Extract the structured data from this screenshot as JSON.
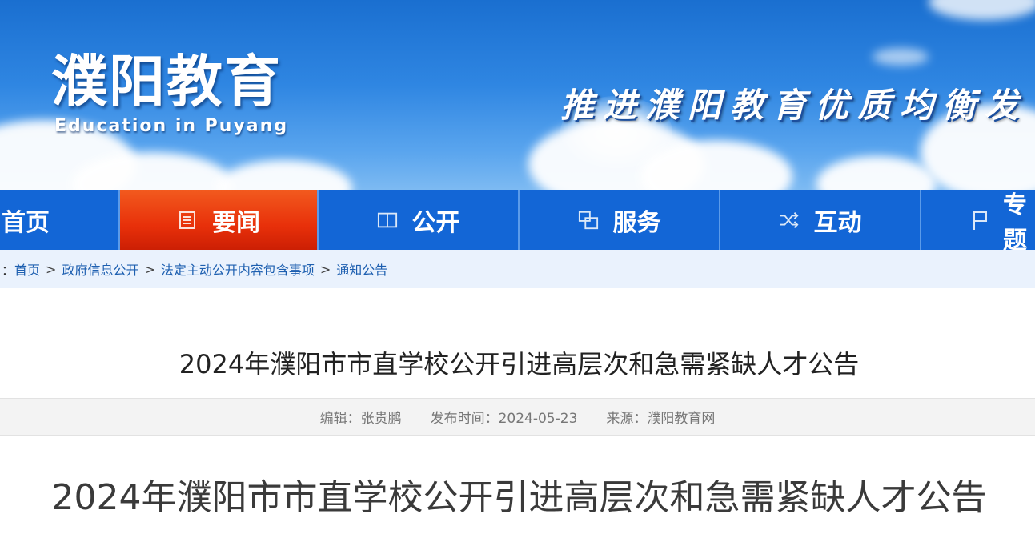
{
  "banner": {
    "logo_cn": "濮阳教育",
    "logo_en": "Education in Puyang",
    "slogan": "推进濮阳教育优质均衡发"
  },
  "nav": {
    "items": [
      {
        "label": "首页",
        "icon": "none",
        "active": false
      },
      {
        "label": "要闻",
        "icon": "news-icon",
        "active": true
      },
      {
        "label": "公开",
        "icon": "book-icon",
        "active": false
      },
      {
        "label": "服务",
        "icon": "service-icon",
        "active": false
      },
      {
        "label": "互动",
        "icon": "shuffle-icon",
        "active": false
      },
      {
        "label": "专题",
        "icon": "flag-icon",
        "active": false
      }
    ]
  },
  "breadcrumb": {
    "prefix": "：",
    "items": [
      "首页",
      "政府信息公开",
      "法定主动公开内容包含事项",
      "通知公告"
    ],
    "separator": ">"
  },
  "article": {
    "title": "2024年濮阳市市直学校公开引进高层次和急需紧缺人才公告",
    "editor": "编辑：张贵鹏",
    "publish_time": "发布时间：2024-05-23",
    "source": "来源：濮阳教育网",
    "body_title": "2024年濮阳市市直学校公开引进高层次和急需紧缺人才公告"
  },
  "colors": {
    "nav_bg": "#1366d6",
    "nav_active": "#e8300a",
    "breadcrumb_bg": "#eaf2fd",
    "link": "#1d5fb0"
  }
}
